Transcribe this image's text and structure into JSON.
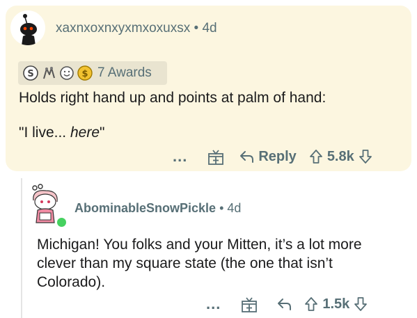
{
  "comment": {
    "username": "xaxnxoxnxyxmxoxuxsx",
    "separator": "•",
    "age": "4d",
    "awards_label": "7 Awards",
    "body_line1": "Holds right hand up and points at palm of hand:",
    "body_quote_start": "\"I live... ",
    "body_quote_emph": "here",
    "body_quote_end": "\"",
    "more": "...",
    "reply_label": "Reply",
    "score": "5.8k"
  },
  "reply": {
    "username": "AbominableSnowPickle",
    "separator": "•",
    "age": "4d",
    "body": "Michigan! You folks and your Mitten, it’s a lot more clever than my square state (the one that isn’t Colorado).",
    "more": "...",
    "score": "1.5k"
  },
  "colors": {
    "highlight_bg": "#fcf6e0",
    "meta_text": "#576f76",
    "online": "#46d160"
  }
}
